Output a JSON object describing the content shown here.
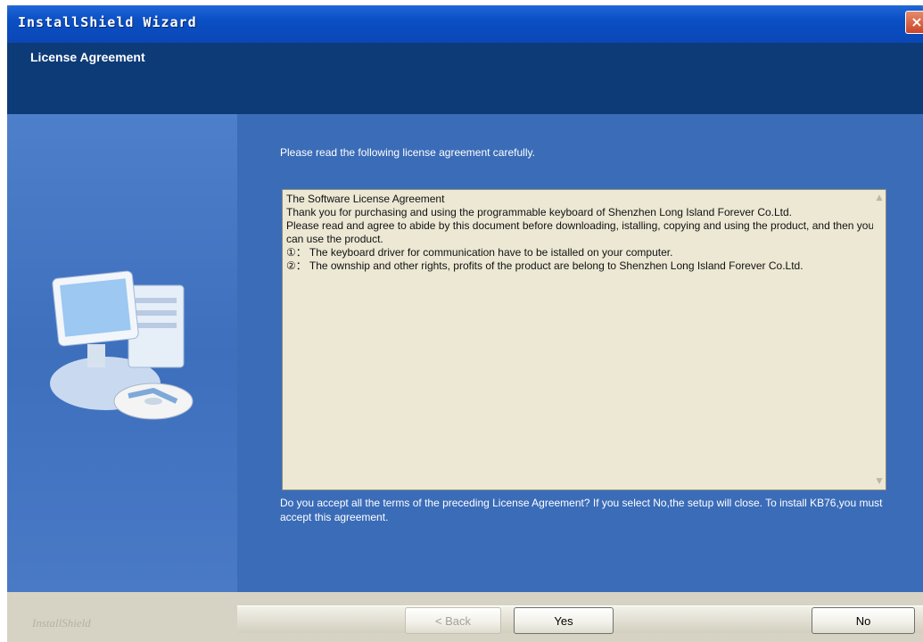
{
  "window": {
    "title": "InstallShield Wizard",
    "close_icon": "×"
  },
  "header": {
    "title": "License Agreement"
  },
  "main": {
    "intro": "Please read the following license agreement carefully.",
    "license_text": "The Software License Agreement\nThank you for purchasing and using the programmable keyboard of Shenzhen Long Island Forever Co.Ltd.\nPlease read and agree to abide by this document before downloading, istalling, copying and using the product, and then you can use the product.\n①： The keyboard driver for communication have to be istalled on your computer.\n②： The ownship and other rights, profits of the product are belong to Shenzhen Long Island Forever Co.Ltd.",
    "question": "Do you accept all the terms of the preceding License Agreement? If you select No,the setup will close. To install KB76,you must accept this agreement."
  },
  "footer": {
    "brand": "InstallShield",
    "back_label": "< Back",
    "yes_label": "Yes",
    "no_label": "No"
  },
  "colors": {
    "title_bar": "#0b47b6",
    "header_band": "#0d3b78",
    "content_bg": "#3b6cb8",
    "license_bg": "#ece8d4"
  }
}
